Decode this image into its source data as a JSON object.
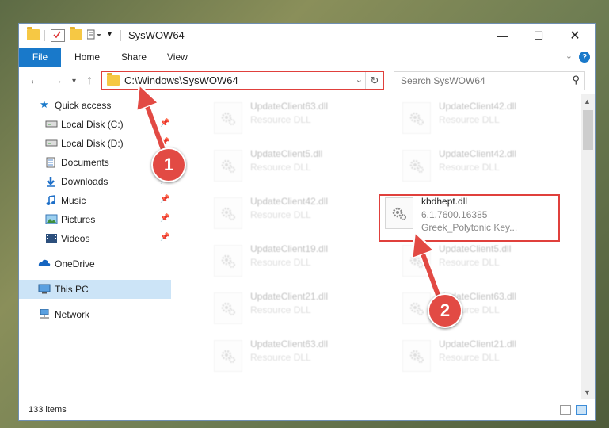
{
  "window": {
    "title": "SysWOW64"
  },
  "ribbon": {
    "file": "File",
    "home": "Home",
    "share": "Share",
    "view": "View"
  },
  "address": {
    "path": "C:\\Windows\\SysWOW64"
  },
  "search": {
    "placeholder": "Search SysWOW64"
  },
  "nav": {
    "quick_access": "Quick access",
    "items": [
      {
        "label": "Local Disk (C:)",
        "icon": "drive-icon",
        "pinned": true
      },
      {
        "label": "Local Disk (D:)",
        "icon": "drive-icon",
        "pinned": true
      },
      {
        "label": "Documents",
        "icon": "documents-icon",
        "pinned": true
      },
      {
        "label": "Downloads",
        "icon": "downloads-icon",
        "pinned": true
      },
      {
        "label": "Music",
        "icon": "music-icon",
        "pinned": true
      },
      {
        "label": "Pictures",
        "icon": "pictures-icon",
        "pinned": true
      },
      {
        "label": "Videos",
        "icon": "videos-icon",
        "pinned": true
      }
    ],
    "onedrive": "OneDrive",
    "this_pc": "This PC",
    "network": "Network"
  },
  "files": {
    "left": [
      {
        "name": "UpdateClient63.dll",
        "desc": "Resource DLL"
      },
      {
        "name": "UpdateClient5.dll",
        "desc": "Resource DLL"
      },
      {
        "name": "UpdateClient42.dll",
        "desc": "Resource DLL"
      },
      {
        "name": "UpdateClient19.dll",
        "desc": "Resource DLL"
      },
      {
        "name": "UpdateClient21.dll",
        "desc": "Resource DLL"
      },
      {
        "name": "UpdateClient63.dll",
        "desc": "Resource DLL"
      }
    ],
    "right": [
      {
        "name": "UpdateClient42.dll",
        "desc": "Resource DLL"
      },
      {
        "name": "UpdateClient42.dll",
        "desc": "Resource DLL"
      },
      {
        "name": "UpdateClient5.dll",
        "desc": "Resource DLL"
      },
      {
        "name": "UpdateClient63.dll",
        "desc": "Resource DLL"
      },
      {
        "name": "UpdateClient21.dll",
        "desc": "Resource DLL"
      }
    ],
    "highlighted": {
      "name": "kbdhept.dll",
      "version": "6.1.7600.16385",
      "desc": "Greek_Polytonic Key..."
    }
  },
  "status": {
    "count": "133 items"
  },
  "callouts": {
    "one": "1",
    "two": "2"
  },
  "colors": {
    "accent": "#1979ca",
    "highlight": "#e0403c"
  }
}
